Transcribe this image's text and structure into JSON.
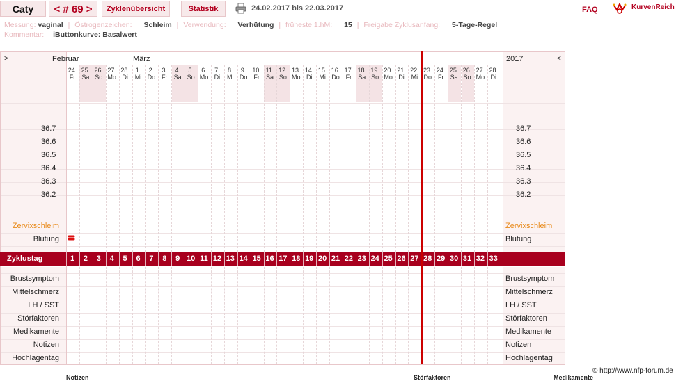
{
  "topbar": {
    "user_name": "Caty",
    "cycle_label": "< # 69 >",
    "tab_overview": "Zyklenübersicht",
    "tab_stats": "Statistik",
    "date_range": "24.02.2017 bis 22.03.2017",
    "faq": "FAQ",
    "brand": "KurvenReich"
  },
  "info": {
    "messung_label": "Messung:",
    "messung_value": "vaginal",
    "oestrogen_label": "Östrogenzeichen:",
    "oestrogen_value": "Schleim",
    "verwendung_label": "Verwendung:",
    "verwendung_value": "Verhütung",
    "hm_label": "früheste 1.hM:",
    "hm_value": "15",
    "freigabe_label": "Freigabe Zyklusanfang:",
    "freigabe_value": "5-Tage-Regel",
    "kommentar_label": "Kommentar:",
    "kommentar_value": "iButtonkurve: Basalwert"
  },
  "chart": {
    "nav_left": ">",
    "nav_right": "<",
    "month_feb": "Februar",
    "month_mar": "März",
    "year": "2017",
    "days": [
      {
        "d": "24.",
        "w": "Fr",
        "we": false
      },
      {
        "d": "25.",
        "w": "Sa",
        "we": true
      },
      {
        "d": "26.",
        "w": "So",
        "we": true
      },
      {
        "d": "27.",
        "w": "Mo",
        "we": false
      },
      {
        "d": "28.",
        "w": "Di",
        "we": false
      },
      {
        "d": "1.",
        "w": "Mi",
        "we": false
      },
      {
        "d": "2.",
        "w": "Do",
        "we": false
      },
      {
        "d": "3.",
        "w": "Fr",
        "we": false
      },
      {
        "d": "4.",
        "w": "Sa",
        "we": true
      },
      {
        "d": "5.",
        "w": "So",
        "we": true
      },
      {
        "d": "6.",
        "w": "Mo",
        "we": false
      },
      {
        "d": "7.",
        "w": "Di",
        "we": false
      },
      {
        "d": "8.",
        "w": "Mi",
        "we": false
      },
      {
        "d": "9.",
        "w": "Do",
        "we": false
      },
      {
        "d": "10.",
        "w": "Fr",
        "we": false
      },
      {
        "d": "11.",
        "w": "Sa",
        "we": true
      },
      {
        "d": "12.",
        "w": "So",
        "we": true
      },
      {
        "d": "13.",
        "w": "Mo",
        "we": false
      },
      {
        "d": "14.",
        "w": "Di",
        "we": false
      },
      {
        "d": "15.",
        "w": "Mi",
        "we": false
      },
      {
        "d": "16.",
        "w": "Do",
        "we": false
      },
      {
        "d": "17.",
        "w": "Fr",
        "we": false
      },
      {
        "d": "18.",
        "w": "Sa",
        "we": true
      },
      {
        "d": "19.",
        "w": "So",
        "we": true
      },
      {
        "d": "20.",
        "w": "Mo",
        "we": false
      },
      {
        "d": "21.",
        "w": "Di",
        "we": false
      },
      {
        "d": "22.",
        "w": "Mi",
        "we": false
      },
      {
        "d": "23.",
        "w": "Do",
        "we": false
      },
      {
        "d": "24.",
        "w": "Fr",
        "we": false
      },
      {
        "d": "25.",
        "w": "Sa",
        "we": true
      },
      {
        "d": "26.",
        "w": "So",
        "we": true
      },
      {
        "d": "27.",
        "w": "Mo",
        "we": false
      },
      {
        "d": "28.",
        "w": "Di",
        "we": false
      }
    ],
    "temps": [
      "36.7",
      "36.6",
      "36.5",
      "36.4",
      "36.3",
      "36.2"
    ],
    "zervix_label": "Zervixschleim",
    "blutung_label": "Blutung",
    "zyklustag_label": "Zyklustag",
    "cycle_days": [
      "1",
      "2",
      "3",
      "4",
      "5",
      "6",
      "7",
      "8",
      "9",
      "10",
      "11",
      "12",
      "13",
      "14",
      "15",
      "16",
      "17",
      "18",
      "19",
      "20",
      "21",
      "22",
      "23",
      "24",
      "25",
      "26",
      "27",
      "28",
      "29",
      "30",
      "31",
      "32",
      "33"
    ],
    "symptom_rows": [
      "Brustsymptom",
      "Mittelschmerz",
      "LH / SST",
      "Störfaktoren",
      "Medikamente",
      "Notizen",
      "Hochlagentag"
    ],
    "colors": {
      "accent": "#a8001e",
      "cursor": "#cc0000",
      "weekend": "#f4e3e5",
      "orange": "#e88a1a"
    }
  },
  "footer": {
    "copyright": "© http://www.nfp-forum.de",
    "notizen": "Notizen",
    "stoerfaktoren": "Störfaktoren",
    "medikamente": "Medikamente"
  }
}
